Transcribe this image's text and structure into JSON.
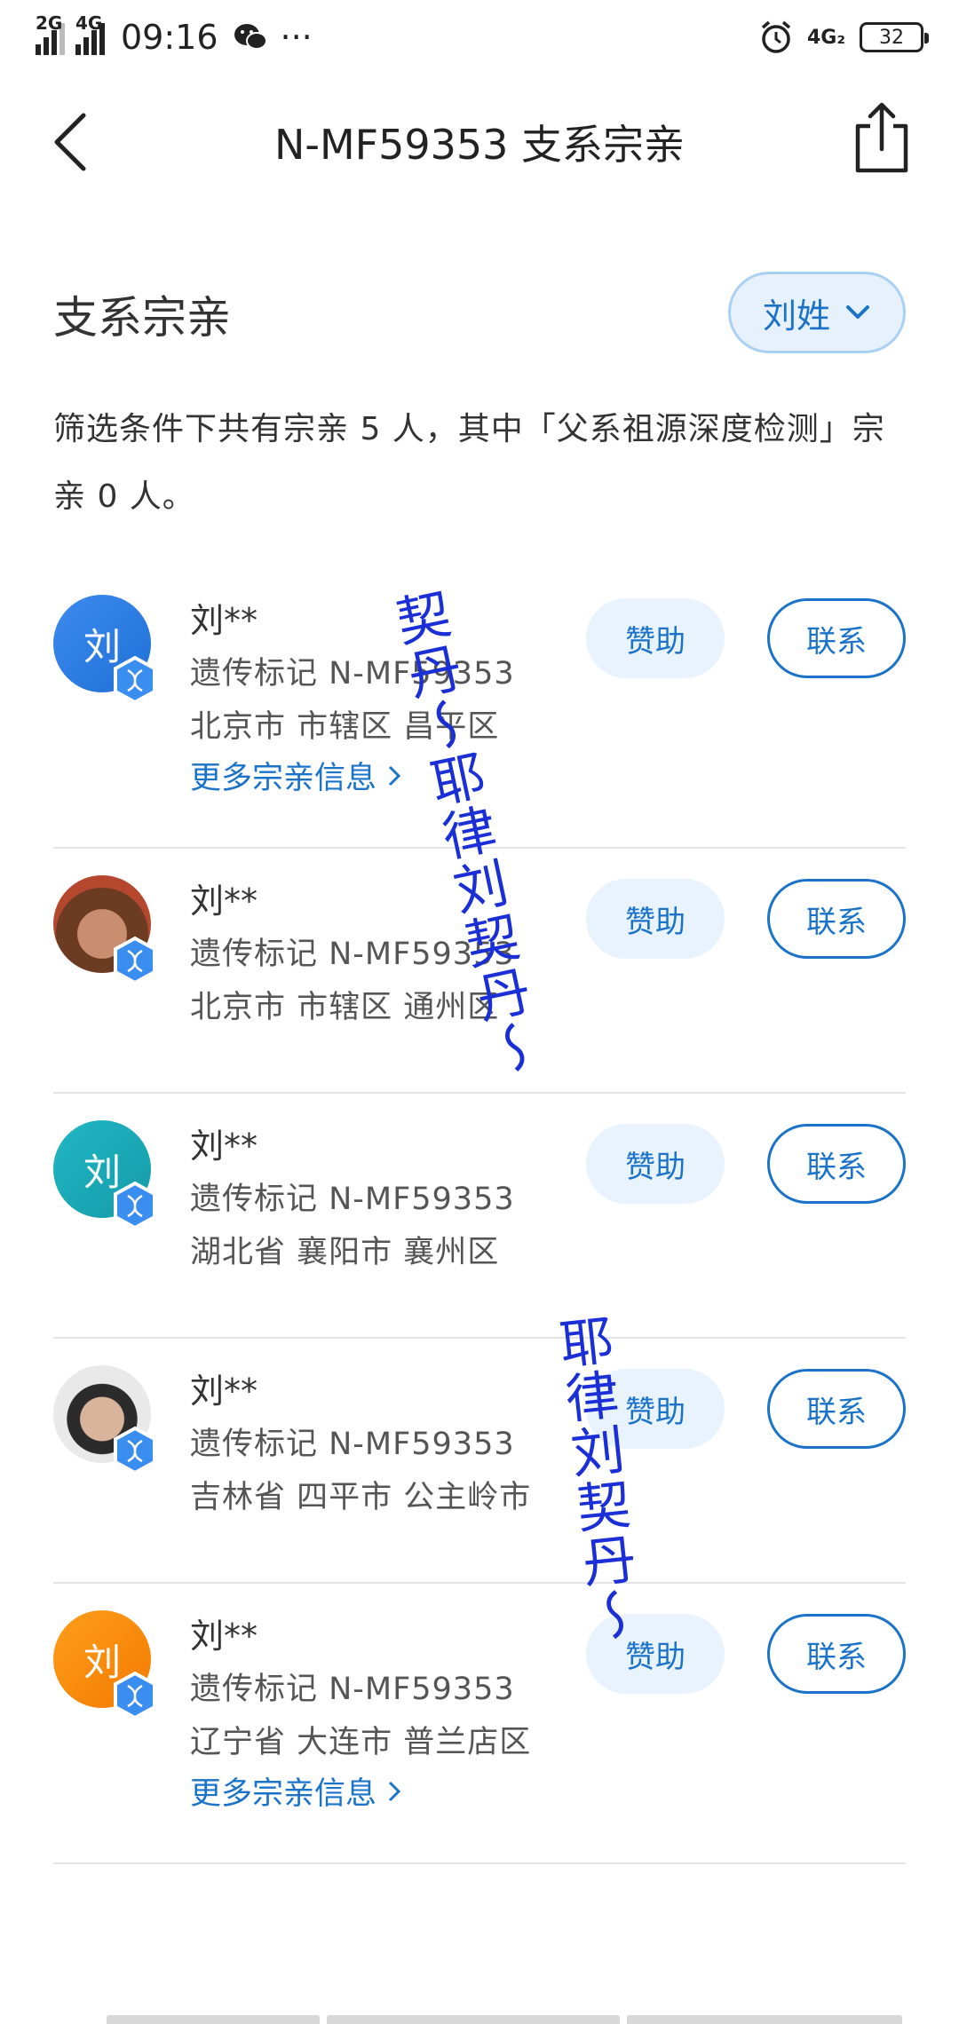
{
  "status_bar": {
    "sim1": "2G",
    "sim2": "4G",
    "time": "09:16",
    "more": "···",
    "network": "4G₂",
    "battery": "32"
  },
  "nav": {
    "title": "N-MF59353 支系宗亲"
  },
  "section": {
    "title": "支系宗亲",
    "filter_label": "刘姓"
  },
  "summary": "筛选条件下共有宗亲 5 人，其中「父系祖源深度检测」宗亲 0 人。",
  "buttons": {
    "sponsor": "赞助",
    "contact": "联系"
  },
  "relatives": [
    {
      "avatar_text": "刘",
      "name": "刘**",
      "marker": "遗传标记 N-MF59353",
      "location": "北京市 市辖区 昌平区",
      "more": "更多宗亲信息"
    },
    {
      "avatar_text": "",
      "name": "刘**",
      "marker": "遗传标记 N-MF59353",
      "location": "北京市 市辖区 通州区",
      "more": ""
    },
    {
      "avatar_text": "刘",
      "name": "刘**",
      "marker": "遗传标记 N-MF59353",
      "location": "湖北省 襄阳市 襄州区",
      "more": ""
    },
    {
      "avatar_text": "",
      "name": "刘**",
      "marker": "遗传标记 N-MF59353",
      "location": "吉林省 四平市 公主岭市",
      "more": ""
    },
    {
      "avatar_text": "刘",
      "name": "刘**",
      "marker": "遗传标记 N-MF59353",
      "location": "辽宁省 大连市 普兰店区",
      "more": "更多宗亲信息"
    }
  ],
  "watermark": {
    "line1": "契丹～耶律刘契丹～",
    "line2": "耶律刘契丹～"
  }
}
